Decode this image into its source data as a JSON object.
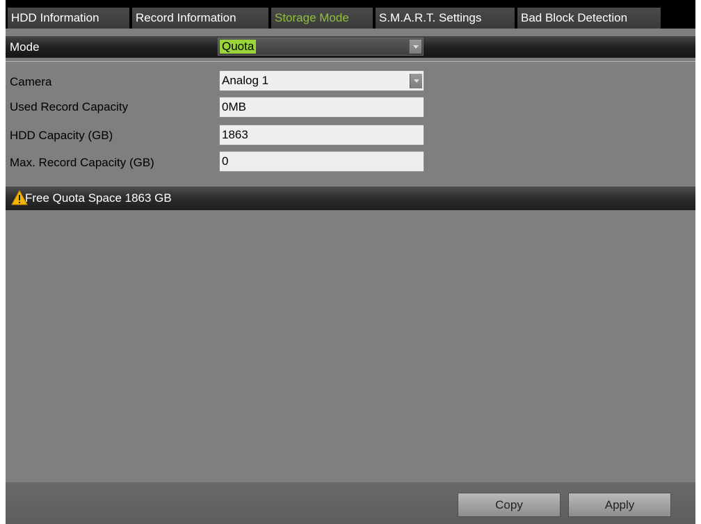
{
  "tabs": [
    {
      "label": "HDD Information",
      "active": false
    },
    {
      "label": "Record Information",
      "active": false
    },
    {
      "label": "Storage Mode",
      "active": true
    },
    {
      "label": "S.M.A.R.T. Settings",
      "active": false
    },
    {
      "label": "Bad Block Detection",
      "active": false
    }
  ],
  "mode": {
    "label": "Mode",
    "value": "Quota"
  },
  "form": {
    "camera": {
      "label": "Camera",
      "value": "Analog 1"
    },
    "used_capacity": {
      "label": "Used Record Capacity",
      "value": "0MB"
    },
    "hdd_capacity": {
      "label": "HDD Capacity (GB)",
      "value": "1863"
    },
    "max_capacity": {
      "label": "Max. Record Capacity (GB)",
      "value": "0"
    }
  },
  "notice": {
    "text": "Free Quota Space 1863 GB",
    "icon": "warning-icon"
  },
  "buttons": {
    "copy": "Copy",
    "apply": "Apply"
  },
  "colors": {
    "active_tab": "#8fc23c",
    "selected_highlight": "#98d43a",
    "warning": "#f5b400"
  }
}
